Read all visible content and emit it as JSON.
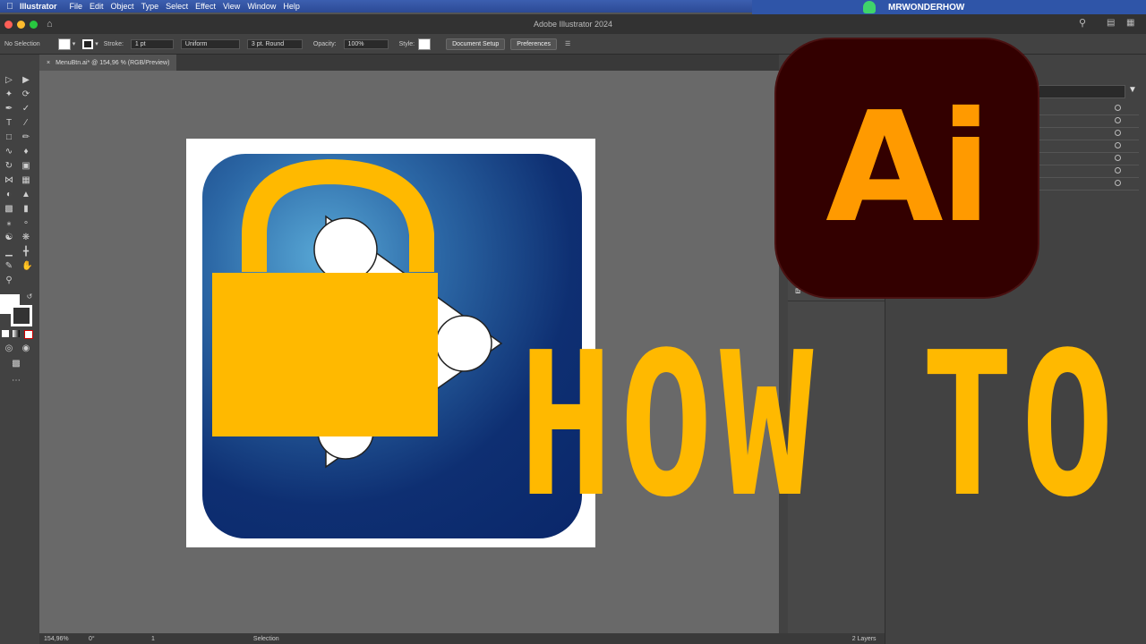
{
  "menubar": {
    "app_name": "Illustrator",
    "items": [
      "File",
      "Edit",
      "Object",
      "Type",
      "Select",
      "Effect",
      "View",
      "Window",
      "Help"
    ]
  },
  "channel": {
    "name": "MRWONDERHOW"
  },
  "window": {
    "title": "Adobe Illustrator 2024"
  },
  "controlbar": {
    "selection": "No Selection",
    "stroke_label": "Stroke:",
    "stroke_value": "1 pt",
    "profile": "Uniform",
    "brush": "3 pt. Round",
    "opacity_label": "Opacity:",
    "opacity_value": "100%",
    "style_label": "Style:",
    "document_setup": "Document Setup",
    "preferences": "Preferences"
  },
  "document": {
    "tab": "MenuBtn.ai* @ 154,96 % (RGB/Preview)"
  },
  "statusbar": {
    "zoom": "154,96%",
    "rotation": "0°",
    "artboard": "1",
    "tool": "Selection",
    "layers": "2 Layers"
  },
  "overlay": {
    "logo_text": "Ai",
    "headline": "HOW TO"
  },
  "colors": {
    "lock": "#ffb900",
    "ai_orange": "#ff9a00",
    "ai_bg": "#330000",
    "icon_blue": "#0e2f72"
  }
}
